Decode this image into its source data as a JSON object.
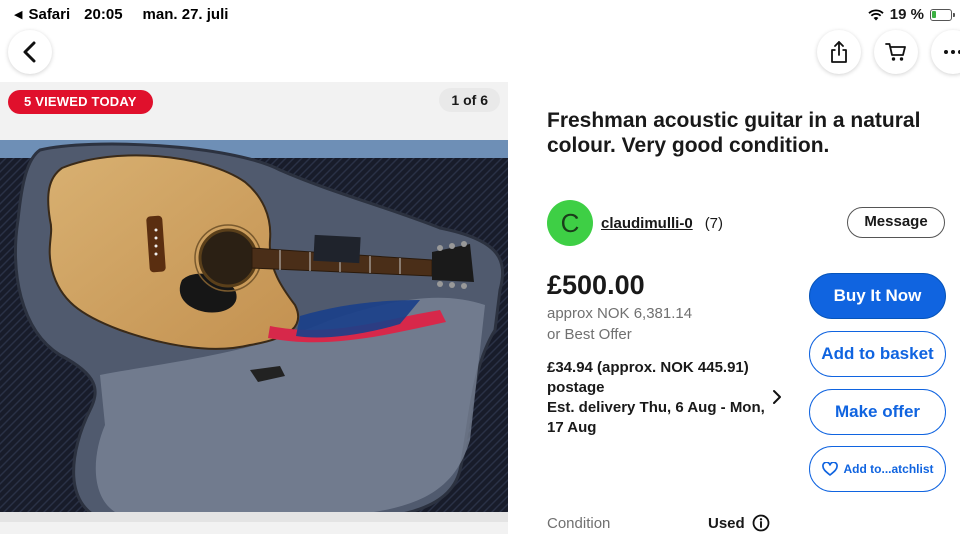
{
  "status_bar": {
    "app": "Safari",
    "time": "20:05",
    "date": "man. 27. juli",
    "battery": "19 %"
  },
  "nav": {
    "back_icon": "chevron-left-icon",
    "share_icon": "share-icon",
    "cart_icon": "cart-icon",
    "more_icon": "ellipsis-icon"
  },
  "gallery": {
    "badge": "5 VIEWED TODAY",
    "counter": "1 of 6",
    "badge_color": "#e0102c"
  },
  "listing": {
    "title": "Freshman acoustic guitar in a natural colour. Very good condition.",
    "seller": {
      "initial": "C",
      "name": "claudimulli-0",
      "feedback": "(7)",
      "avatar_color": "#3ecf45"
    },
    "message_label": "Message",
    "price": "£500.00",
    "approx_price": "approx NOK 6,381.14",
    "best_offer": "or Best Offer",
    "shipping": {
      "cost": "£34.94 (approx. NOK 445.91)",
      "label": "postage",
      "delivery": "Est. delivery Thu, 6 Aug - Mon, 17 Aug"
    },
    "actions": {
      "buy_now": "Buy It Now",
      "add_to_basket": "Add to basket",
      "make_offer": "Make offer",
      "watchlist": "Add to...atchlist"
    },
    "condition": {
      "label": "Condition",
      "value": "Used"
    }
  },
  "colors": {
    "accent_blue": "#1064e0"
  }
}
